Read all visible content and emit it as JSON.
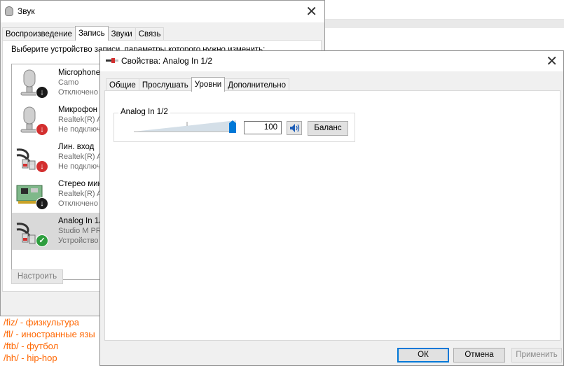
{
  "background": {
    "links": [
      "/fiz/ - физкультура",
      "/fl/ - иностранные язы",
      "/ftb/ - футбол",
      "/hh/ - hip-hop"
    ],
    "link_color": "#ff6600"
  },
  "sound_window": {
    "title": "Звук",
    "title_icon": "speaker-icon",
    "close_icon": "close-icon",
    "tabs": [
      "Воспроизведение",
      "Запись",
      "Звуки",
      "Связь"
    ],
    "active_tab": "Запись",
    "hint": "Выберите устройство записи, параметры которого нужно изменить:",
    "devices": [
      {
        "name": "Microphone",
        "sub": "Camo",
        "status": "Отключено",
        "icon": "microphone-icon",
        "badge": "down-arrow-icon",
        "badge_color": "#1a1a1a"
      },
      {
        "name": "Микрофон",
        "sub": "Realtek(R) A",
        "status": "Не подключ",
        "icon": "microphone-icon",
        "badge": "down-arrow-icon",
        "badge_color": "#d32f2f"
      },
      {
        "name": "Лин. вход",
        "sub": "Realtek(R) A",
        "status": "Не подключ",
        "icon": "rca-cable-icon",
        "badge": "down-arrow-icon",
        "badge_color": "#d32f2f"
      },
      {
        "name": "Стерео мик",
        "sub": "Realtek(R) A",
        "status": "Отключено",
        "icon": "sound-card-icon",
        "badge": "down-arrow-icon",
        "badge_color": "#1a1a1a"
      },
      {
        "name": "Analog In 1/",
        "sub": "Studio M PR",
        "status": "Устройство",
        "icon": "rca-cable-icon",
        "badge": "checkmark-icon",
        "badge_color": "#2e9e3e",
        "selected": true
      }
    ],
    "configure_label": "Настроить"
  },
  "props_window": {
    "title": "Свойства: Analog In 1/2",
    "title_icon": "rca-cable-icon",
    "close_icon": "close-icon",
    "tabs": [
      "Общие",
      "Прослушать",
      "Уровни",
      "Дополнительно"
    ],
    "active_tab": "Уровни",
    "level": {
      "label": "Analog In 1/2",
      "value": "100",
      "slider_fraction": 1.0,
      "speaker_icon": "speaker-icon",
      "balance_label": "Баланс"
    },
    "buttons": {
      "ok": "ОК",
      "cancel": "Отмена",
      "apply": "Применить"
    },
    "accent": "#0078d7"
  }
}
